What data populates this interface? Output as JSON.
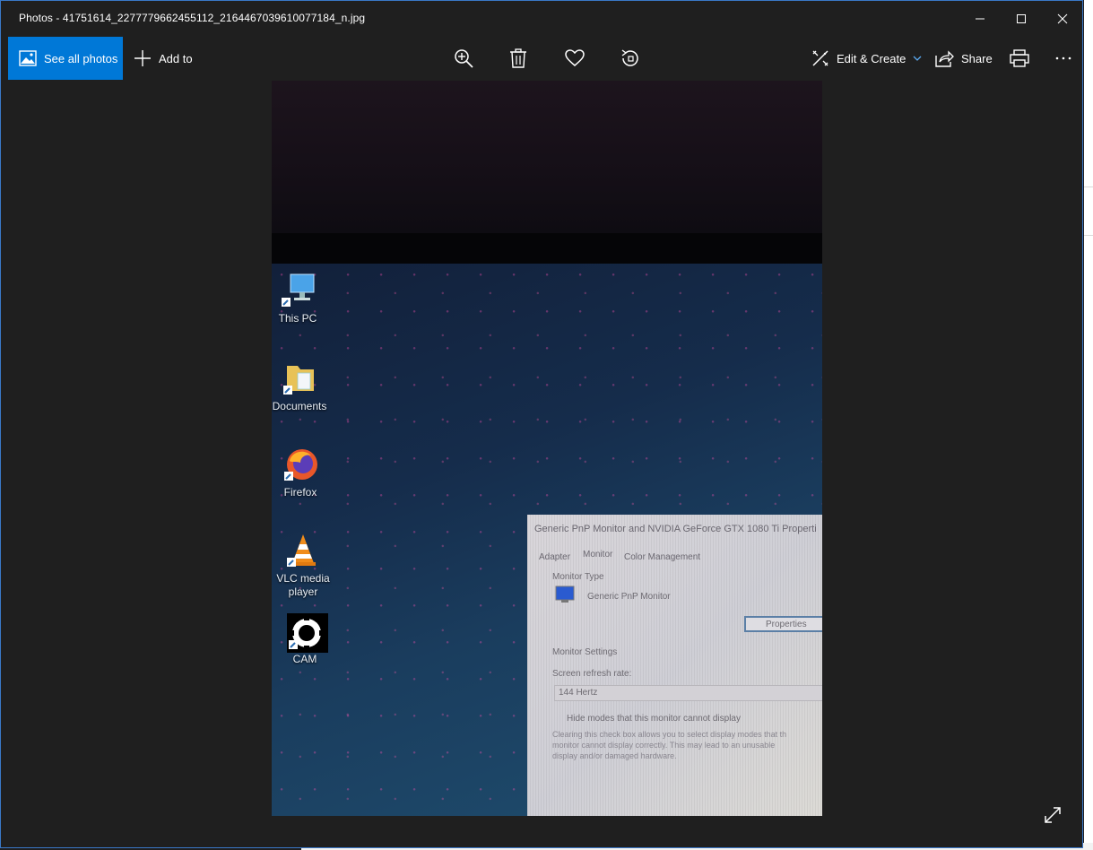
{
  "window": {
    "title": "Photos - 41751614_2277779662455112_2164467039610077184_n.jpg",
    "controls": {
      "minimize": "minimize-icon",
      "maximize": "maximize-icon",
      "close": "close-icon"
    }
  },
  "toolbar": {
    "see_all_photos": "See all photos",
    "add_to": "Add to",
    "edit_create": "Edit & Create",
    "share": "Share",
    "accent_color": "#0078d7"
  },
  "photo": {
    "desktop_icons": [
      {
        "label": "This PC"
      },
      {
        "label": "Documents"
      },
      {
        "label": "Firefox"
      },
      {
        "label_line1": "VLC media",
        "label_line2": "player"
      },
      {
        "label": "CAM"
      }
    ],
    "dialog": {
      "title": "Generic PnP Monitor and NVIDIA GeForce GTX 1080 Ti Properti",
      "tabs": [
        "Adapter",
        "Monitor",
        "Color Management"
      ],
      "monitor_type_label": "Monitor Type",
      "monitor_name": "Generic PnP Monitor",
      "properties_button": "Properties",
      "monitor_settings_label": "Monitor Settings",
      "refresh_rate_label": "Screen refresh rate:",
      "refresh_rate_value": "144 Hertz",
      "hide_modes": "Hide modes that this monitor cannot display",
      "hint_line1": "Clearing this check box allows you to select display modes that th",
      "hint_line2": "monitor cannot display correctly. This may lead to an unusable",
      "hint_line3": "display and/or damaged hardware."
    }
  }
}
